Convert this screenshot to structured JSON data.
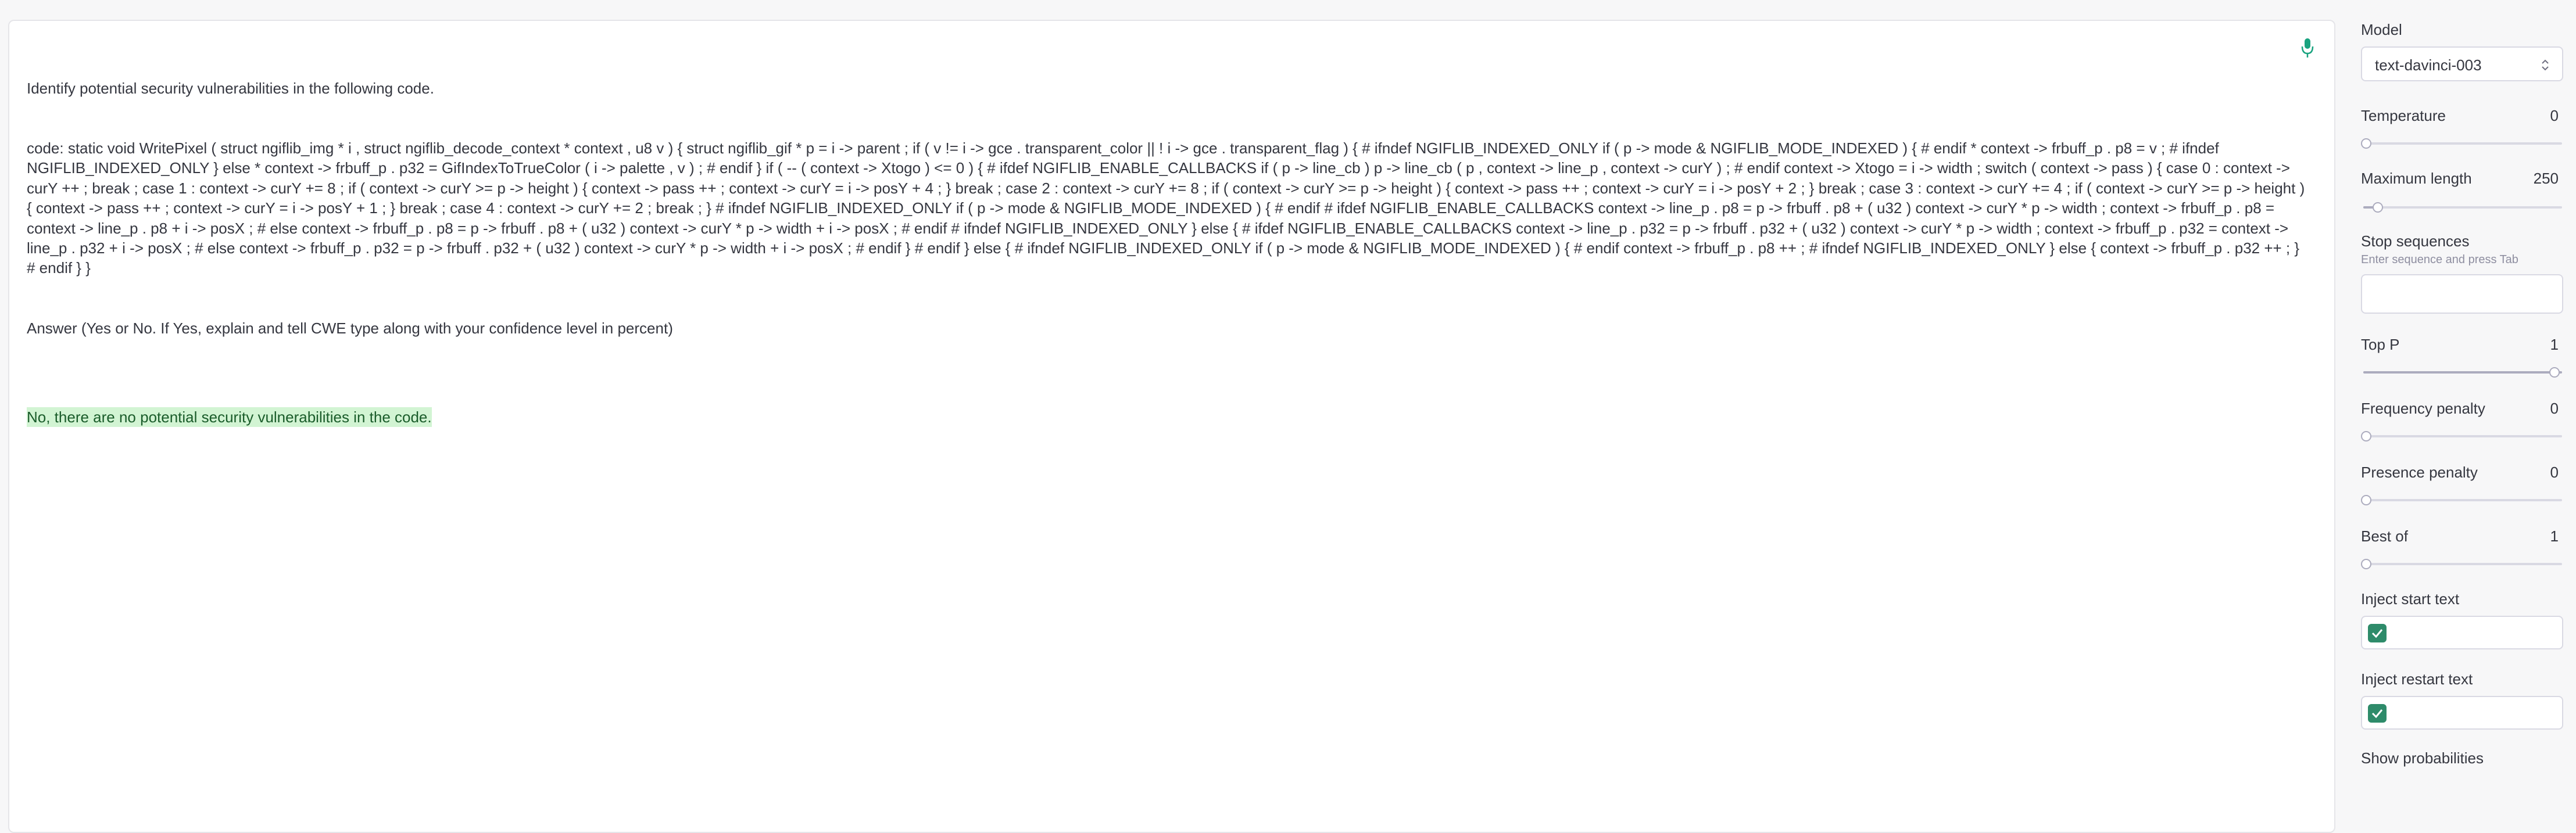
{
  "prompt": {
    "instruction": "Identify potential security vulnerabilities in the following code.",
    "code": "code: static void WritePixel ( struct ngiflib_img * i , struct ngiflib_decode_context * context , u8 v ) { struct ngiflib_gif * p = i -> parent ; if ( v != i -> gce . transparent_color || ! i -> gce . transparent_flag ) { # ifndef NGIFLIB_INDEXED_ONLY if ( p -> mode & NGIFLIB_MODE_INDEXED ) { # endif * context -> frbuff_p . p8 = v ; # ifndef NGIFLIB_INDEXED_ONLY } else * context -> frbuff_p . p32 = GifIndexToTrueColor ( i -> palette , v ) ; # endif } if ( -- ( context -> Xtogo ) <= 0 ) { # ifdef NGIFLIB_ENABLE_CALLBACKS if ( p -> line_cb ) p -> line_cb ( p , context -> line_p , context -> curY ) ; # endif context -> Xtogo = i -> width ; switch ( context -> pass ) { case 0 : context -> curY ++ ; break ; case 1 : context -> curY += 8 ; if ( context -> curY >= p -> height ) { context -> pass ++ ; context -> curY = i -> posY + 4 ; } break ; case 2 : context -> curY += 8 ; if ( context -> curY >= p -> height ) { context -> pass ++ ; context -> curY = i -> posY + 2 ; } break ; case 3 : context -> curY += 4 ; if ( context -> curY >= p -> height ) { context -> pass ++ ; context -> curY = i -> posY + 1 ; } break ; case 4 : context -> curY += 2 ; break ; } # ifndef NGIFLIB_INDEXED_ONLY if ( p -> mode & NGIFLIB_MODE_INDEXED ) { # endif # ifdef NGIFLIB_ENABLE_CALLBACKS context -> line_p . p8 = p -> frbuff . p8 + ( u32 ) context -> curY * p -> width ; context -> frbuff_p . p8 = context -> line_p . p8 + i -> posX ; # else context -> frbuff_p . p8 = p -> frbuff . p8 + ( u32 ) context -> curY * p -> width + i -> posX ; # endif # ifndef NGIFLIB_INDEXED_ONLY } else { # ifdef NGIFLIB_ENABLE_CALLBACKS context -> line_p . p32 = p -> frbuff . p32 + ( u32 ) context -> curY * p -> width ; context -> frbuff_p . p32 = context -> line_p . p32 + i -> posX ; # else context -> frbuff_p . p32 = p -> frbuff . p32 + ( u32 ) context -> curY * p -> width + i -> posX ; # endif } # endif } else { # ifndef NGIFLIB_INDEXED_ONLY if ( p -> mode & NGIFLIB_MODE_INDEXED ) { # endif context -> frbuff_p . p8 ++ ; # ifndef NGIFLIB_INDEXED_ONLY } else { context -> frbuff_p . p32 ++ ; } # endif } }",
    "question": "Answer (Yes or No. If Yes, explain and tell CWE type along with your confidence level in percent)",
    "completion": "No, there are no potential security vulnerabilities in the code."
  },
  "settings": {
    "model": {
      "label": "Model",
      "value": "text-davinci-003"
    },
    "temperature": {
      "label": "Temperature",
      "value": "0",
      "fraction": 0
    },
    "max_length": {
      "label": "Maximum length",
      "value": "250",
      "fraction": 0.061
    },
    "stop_sequences": {
      "label": "Stop sequences",
      "hint": "Enter sequence and press Tab"
    },
    "top_p": {
      "label": "Top P",
      "value": "1",
      "fraction": 1
    },
    "frequency_penalty": {
      "label": "Frequency penalty",
      "value": "0",
      "fraction": 0
    },
    "presence_penalty": {
      "label": "Presence penalty",
      "value": "0",
      "fraction": 0
    },
    "best_of": {
      "label": "Best of",
      "value": "1",
      "fraction": 0
    },
    "inject_start": {
      "label": "Inject start text",
      "checked": true
    },
    "inject_restart": {
      "label": "Inject restart text",
      "checked": true
    },
    "show_probabilities": {
      "label": "Show probabilities"
    }
  },
  "colors": {
    "accent": "#2e8b6a",
    "completion_bg": "#d2f4d3"
  }
}
